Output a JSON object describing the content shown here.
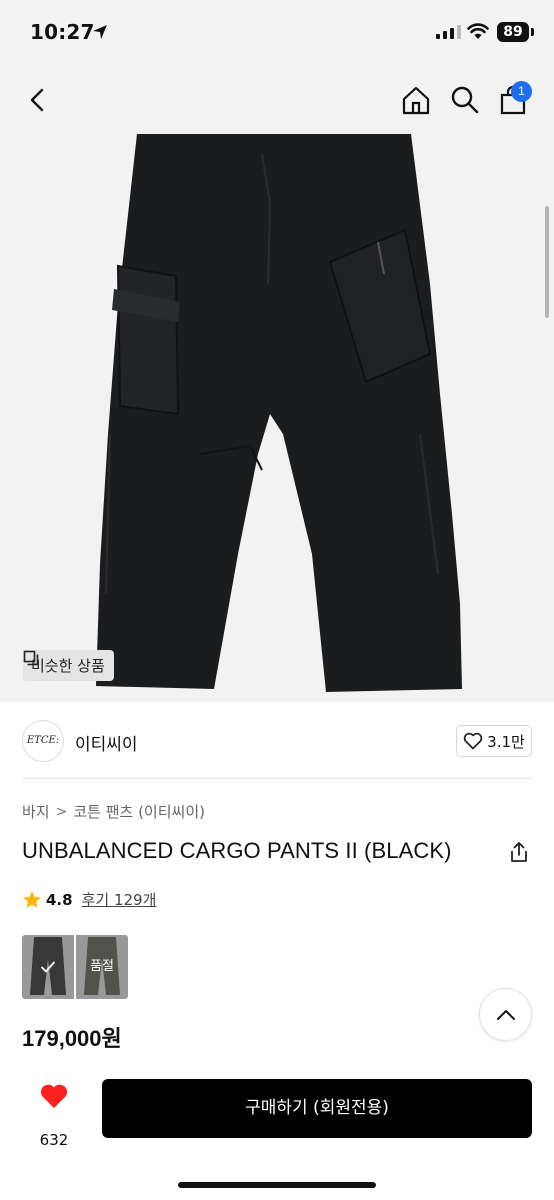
{
  "status_bar": {
    "time": "10:27",
    "battery": "89"
  },
  "header": {
    "cart_count": "1"
  },
  "product_image": {
    "similar_label": "비슷한 상품"
  },
  "brand": {
    "logo_text": "ETCE:",
    "name": "이티씨이",
    "likes": "3.1만"
  },
  "breadcrumb": {
    "category": "바지",
    "separator": ">",
    "subcategory": "코튼 팬츠 (이티씨이)"
  },
  "product": {
    "title": "UNBALANCED CARGO PANTS II (BLACK)",
    "rating": "4.8",
    "reviews": "후기 129개",
    "price": "179,000원"
  },
  "options": [
    {
      "color": "#111111",
      "selected": true
    },
    {
      "color": "#4c4c40",
      "sold_out_label": "품절"
    }
  ],
  "bottom_bar": {
    "wish_count": "632",
    "buy_label": "구매하기 (회원전용)"
  },
  "colors": {
    "accent": "#1e6ff0",
    "heart": "#ff1f1f",
    "star": "#ffb800",
    "buy_button": "#000000"
  }
}
